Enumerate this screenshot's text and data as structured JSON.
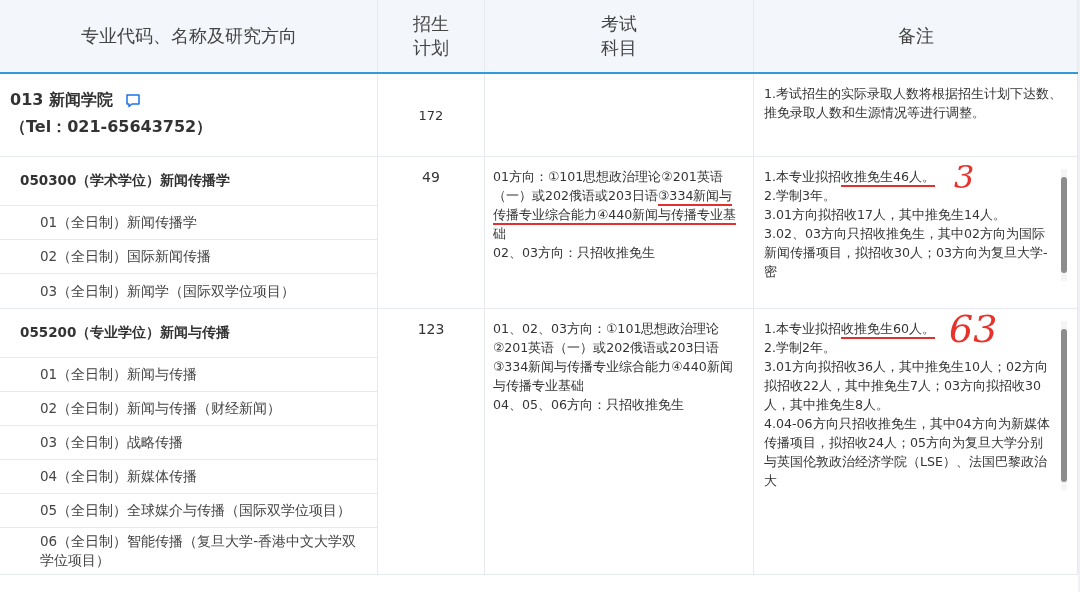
{
  "table": {
    "columns": [
      "专业代码、名称及研究方向",
      "招生计划",
      "考试科目",
      "备注"
    ],
    "department": {
      "name": "013 新闻学院",
      "tel": "（Tel：021-65643752）",
      "plan": "172",
      "notes": [
        "1.考试招生的实际录取人数将根据招生计划下达数、推免录取人数和生源情况等进行调整。"
      ]
    },
    "majors": [
      {
        "name": "050300（学术学位）新闻传播学",
        "plan": "49",
        "annotation": "3",
        "directions": [
          "01（全日制）新闻传播学",
          "02（全日制）国际新闻传播",
          "03（全日制）新闻学（国际双学位项目）"
        ],
        "exam": [
          [
            {
              "text": "01方向：①101思想政治理论②201英语（一）或202俄语或203日语",
              "marked": false
            },
            {
              "text": "③334新闻与传播专业综合能力④440新闻与传播专业基",
              "marked": true
            },
            {
              "text": "础",
              "marked": false
            }
          ],
          [
            {
              "text": "02、03方向：只招收推免生",
              "marked": false
            }
          ]
        ],
        "notes": [
          [
            {
              "text": "1.本专业拟招",
              "marked": false
            },
            {
              "text": "收推免生46人。",
              "marked": true
            }
          ],
          [
            {
              "text": "2.学制3年。",
              "marked": false
            }
          ],
          [
            {
              "text": "3.01方向拟招收17人，其中推免生14人。",
              "marked": false
            }
          ],
          [
            {
              "text": "3.02、03方向只招收推免生，其中02方向为国际新闻传播项目，拟招收30人；03方向为复旦大学-密",
              "marked": false
            }
          ]
        ]
      },
      {
        "name": "055200（专业学位）新闻与传播",
        "plan": "123",
        "annotation": "63",
        "directions": [
          "01（全日制）新闻与传播",
          "02（全日制）新闻与传播（财经新闻）",
          "03（全日制）战略传播",
          "04（全日制）新媒体传播",
          "05（全日制）全球媒介与传播（国际双学位项目）",
          "06（全日制）智能传播（复旦大学-香港中文大学双学位项目）"
        ],
        "exam": [
          [
            {
              "text": "01、02、03方向：①101思想政治理论②201英语（一）或202俄语或203日语③334新闻与传播专业综合能力④440新闻与传播专业基础",
              "marked": false
            }
          ],
          [
            {
              "text": "04、05、06方向：只招收推免生",
              "marked": false
            }
          ]
        ],
        "notes": [
          [
            {
              "text": "1.本专业拟招",
              "marked": false
            },
            {
              "text": "收推免生60人。",
              "marked": true
            }
          ],
          [
            {
              "text": "2.学制2年。",
              "marked": false
            }
          ],
          [
            {
              "text": "3.01方向拟招收36人，其中推免生10人；02方向拟招收22人，其中推免生7人；03方向拟招收30人，其中推免生8人。",
              "marked": false
            }
          ],
          [
            {
              "text": "4.04-06方向只招收推免生，其中04方向为新媒体传播项目，拟招收24人；05方向为复旦大学分别与英国伦敦政治经济学院（LSE）、法国巴黎政治大",
              "marked": false
            }
          ]
        ]
      }
    ]
  }
}
